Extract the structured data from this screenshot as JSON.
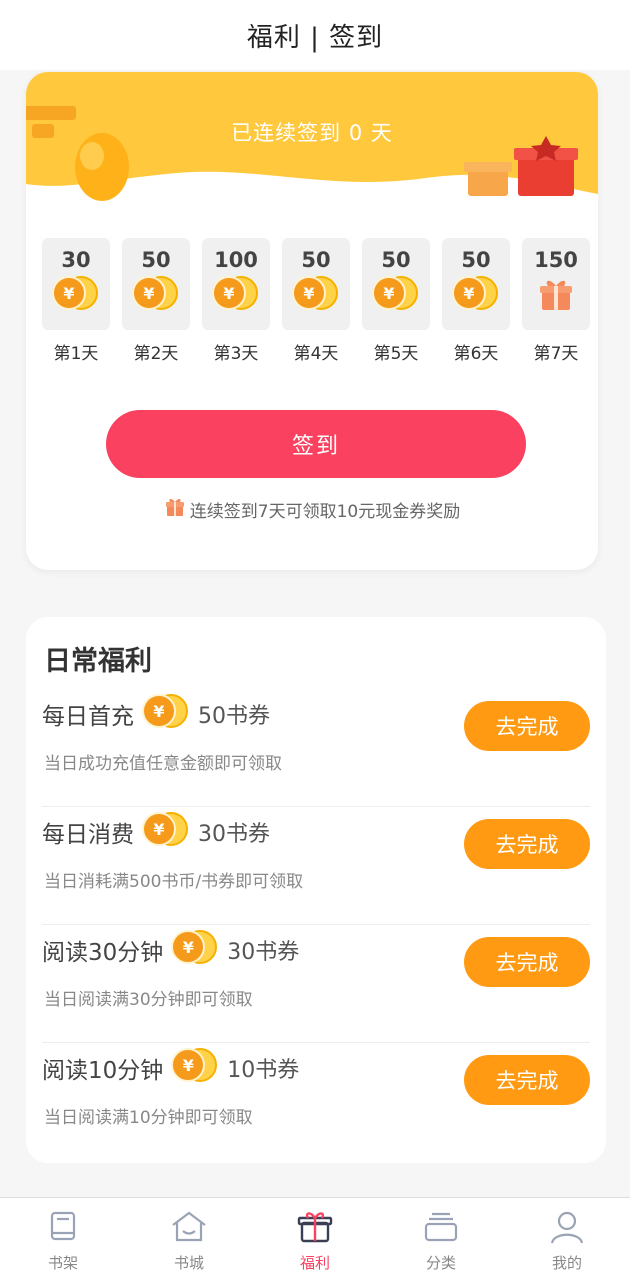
{
  "header": {
    "title": "福利 | 签到"
  },
  "signin": {
    "streak_text": "已连续签到 0 天",
    "days": [
      {
        "amount": "30",
        "label": "第1天",
        "icon": "coin-icon"
      },
      {
        "amount": "50",
        "label": "第2天",
        "icon": "coin-icon"
      },
      {
        "amount": "100",
        "label": "第3天",
        "icon": "coin-icon"
      },
      {
        "amount": "50",
        "label": "第4天",
        "icon": "coin-icon"
      },
      {
        "amount": "50",
        "label": "第5天",
        "icon": "coin-icon"
      },
      {
        "amount": "50",
        "label": "第6天",
        "icon": "coin-icon"
      },
      {
        "amount": "150",
        "label": "第7天",
        "icon": "gift-icon"
      }
    ],
    "button_label": "签到",
    "reward_tip": "连续签到7天可领取10元现金券奖励"
  },
  "daily": {
    "title": "日常福利",
    "tasks": [
      {
        "name": "每日首充",
        "reward": "50书券",
        "desc": "当日成功充值任意金额即可领取",
        "button": "去完成"
      },
      {
        "name": "每日消费",
        "reward": "30书券",
        "desc": "当日消耗满500书币/书券即可领取",
        "button": "去完成"
      },
      {
        "name": "阅读30分钟",
        "reward": "30书券",
        "desc": "当日阅读满30分钟即可领取",
        "button": "去完成"
      },
      {
        "name": "阅读10分钟",
        "reward": "10书券",
        "desc": "当日阅读满10分钟即可领取",
        "button": "去完成"
      }
    ]
  },
  "coin_symbol": "¥",
  "tabbar": {
    "items": [
      {
        "label": "书架",
        "icon": "bookshelf-icon"
      },
      {
        "label": "书城",
        "icon": "bookstore-icon"
      },
      {
        "label": "福利",
        "icon": "gift-icon"
      },
      {
        "label": "分类",
        "icon": "category-icon"
      },
      {
        "label": "我的",
        "icon": "profile-icon"
      }
    ]
  },
  "colors": {
    "accent": "#fa4160",
    "banner": "#ffc83d",
    "task_button": "#ff9a12",
    "coin": "#f59a1a"
  }
}
